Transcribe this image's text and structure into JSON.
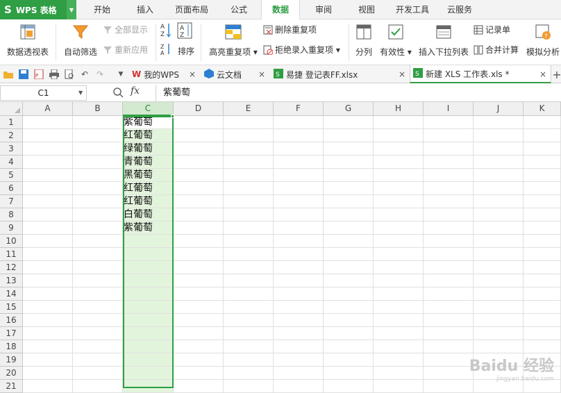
{
  "app": {
    "logo": "S",
    "title": "WPS 表格"
  },
  "menu": [
    "开始",
    "插入",
    "页面布局",
    "公式",
    "数据",
    "审阅",
    "视图",
    "开发工具",
    "云服务"
  ],
  "active_menu": "数据",
  "ribbon": {
    "pivot": "数据透视表",
    "autofilter": "自动筛选",
    "show_all": "全部显示",
    "reapply": "重新应用",
    "sort": "排序",
    "highlight_dup": "高亮重复项",
    "remove_dup": "删除重复项",
    "reject_dup": "拒绝录入重复项",
    "split": "分列",
    "validity": "有效性",
    "insert_dropdown": "插入下拉列表",
    "record_form": "记录单",
    "consolidate": "合并计算",
    "simulate": "模拟分析"
  },
  "doc_tabs": [
    {
      "label": "我的WPS"
    },
    {
      "label": "云文档"
    },
    {
      "label": "易捷 登记表FF.xlsx"
    },
    {
      "label": "新建 XLS 工作表.xls *"
    }
  ],
  "formula_bar": {
    "name_box": "C1",
    "fx": "fx",
    "content": "紫葡萄"
  },
  "columns": [
    "A",
    "B",
    "C",
    "D",
    "E",
    "F",
    "G",
    "H",
    "I",
    "J",
    "K"
  ],
  "selected_column": "C",
  "rows": [
    "1",
    "2",
    "3",
    "4",
    "5",
    "6",
    "7",
    "8",
    "9",
    "10",
    "11",
    "12",
    "13",
    "14",
    "15",
    "16",
    "17",
    "18",
    "19",
    "20",
    "21"
  ],
  "column_c_values": [
    "紫葡萄",
    "红葡萄",
    "绿葡萄",
    "青葡萄",
    "黑葡萄",
    "红葡萄",
    "红葡萄",
    "白葡萄",
    "紫葡萄"
  ],
  "watermark": {
    "text": "Baidu 经验",
    "url": "jingyan.baidu.com"
  },
  "colors": {
    "accent": "#2f9e44",
    "selection": "#e3f4dc"
  }
}
